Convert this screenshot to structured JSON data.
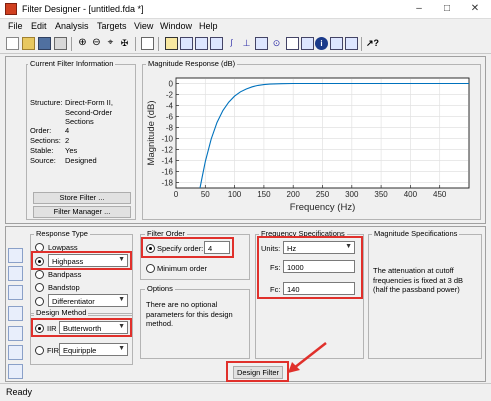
{
  "window": {
    "title": "Filter Designer - [untitled.fda *]"
  },
  "menu": [
    "File",
    "Edit",
    "Analysis",
    "Targets",
    "View",
    "Window",
    "Help"
  ],
  "info": {
    "legend": "Current Filter Information",
    "rows": [
      {
        "k": "Structure:",
        "v": "Direct-Form II, Second-Order Sections"
      },
      {
        "k": "Order:",
        "v": "4"
      },
      {
        "k": "Sections:",
        "v": "2"
      },
      {
        "k": "Stable:",
        "v": "Yes"
      },
      {
        "k": "Source:",
        "v": "Designed"
      }
    ],
    "store_btn": "Store Filter ...",
    "manager_btn": "Filter Manager ..."
  },
  "plot": {
    "legend": "Magnitude Response (dB)",
    "ylabel": "Magnitude (dB)",
    "xlabel": "Frequency (Hz)",
    "xticks": [
      "0",
      "50",
      "100",
      "150",
      "200",
      "250",
      "300",
      "350",
      "400",
      "450"
    ],
    "yticks": [
      "0",
      "-2",
      "-4",
      "-6",
      "-8",
      "-10",
      "-12",
      "-14",
      "-16",
      "-18"
    ]
  },
  "chart_data": {
    "type": "line",
    "title": "",
    "xlabel": "Frequency (Hz)",
    "ylabel": "Magnitude (dB)",
    "xlim": [
      0,
      500
    ],
    "ylim": [
      -19,
      1
    ],
    "grid": true,
    "series": [
      {
        "values": [
          [
            41,
            -19
          ],
          [
            45,
            -16.8
          ],
          [
            50,
            -14.2
          ],
          [
            60,
            -10.1
          ],
          [
            70,
            -7.1
          ],
          [
            80,
            -4.9
          ],
          [
            90,
            -3.4
          ],
          [
            100,
            -2.3
          ],
          [
            110,
            -1.5
          ],
          [
            120,
            -1.0
          ],
          [
            130,
            -0.6
          ],
          [
            140,
            -0.35
          ],
          [
            150,
            -0.2
          ],
          [
            160,
            -0.1
          ],
          [
            180,
            -0.04
          ],
          [
            200,
            0
          ],
          [
            300,
            0
          ],
          [
            400,
            0
          ],
          [
            500,
            0
          ]
        ]
      }
    ]
  },
  "response_type": {
    "legend": "Response Type",
    "options": [
      "Lowpass",
      "Highpass",
      "Bandpass",
      "Bandstop",
      "Differentiator"
    ]
  },
  "design_method": {
    "legend": "Design Method",
    "iir": "IIR",
    "iir_value": "Butterworth",
    "fir": "FIR",
    "fir_value": "Equiripple"
  },
  "filter_order": {
    "legend": "Filter Order",
    "specify": "Specify order:",
    "order_value": "4",
    "minimum": "Minimum order"
  },
  "options": {
    "legend": "Options",
    "text": "There are no optional parameters for this design method."
  },
  "freq_specs": {
    "legend": "Frequency Specifications",
    "units_label": "Units:",
    "units_value": "Hz",
    "fs_label": "Fs:",
    "fs_value": "1000",
    "fc_label": "Fc:",
    "fc_value": "140"
  },
  "mag_specs": {
    "legend": "Magnitude Specifications",
    "text": "The attenuation at cutoff frequencies is fixed at 3 dB (half the passband power)"
  },
  "design_btn": "Design Filter",
  "status": "Ready",
  "colors": {
    "line": "#0072bd",
    "highlight": "#e0302b"
  }
}
